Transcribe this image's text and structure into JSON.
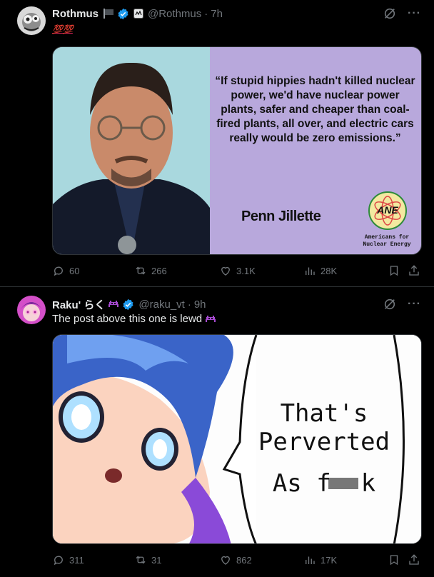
{
  "post1": {
    "name": "Rothmus",
    "handle": "@Rothmus",
    "time": "7h",
    "text": "💯💯",
    "quote": {
      "text": "“If stupid hippies hadn't killed nuclear power, we'd have nuclear power plants, safer and cheaper than coal-fired plants, all over, and electric cars really would be zero emissions.”",
      "author": "Penn Jillette",
      "logo": "ANE",
      "org_line1": "Americans for",
      "org_line2": "Nuclear Energy"
    },
    "stats": {
      "replies": "60",
      "reposts": "266",
      "likes": "3.1K",
      "views": "28K"
    }
  },
  "post2": {
    "name": "Raku' らく",
    "handle": "@raku_vt",
    "time": "9h",
    "text": "The post above this one is lewd",
    "meme": {
      "line1": "That's",
      "line2": "Perverted",
      "line3": "As f",
      "line4": "k"
    },
    "stats": {
      "replies": "311",
      "reposts": "31",
      "likes": "862",
      "views": "17K"
    }
  },
  "colors": {
    "background": "#000000",
    "muted": "#71767b",
    "verified": "#1d9bf0",
    "text": "#e7e9ea"
  }
}
